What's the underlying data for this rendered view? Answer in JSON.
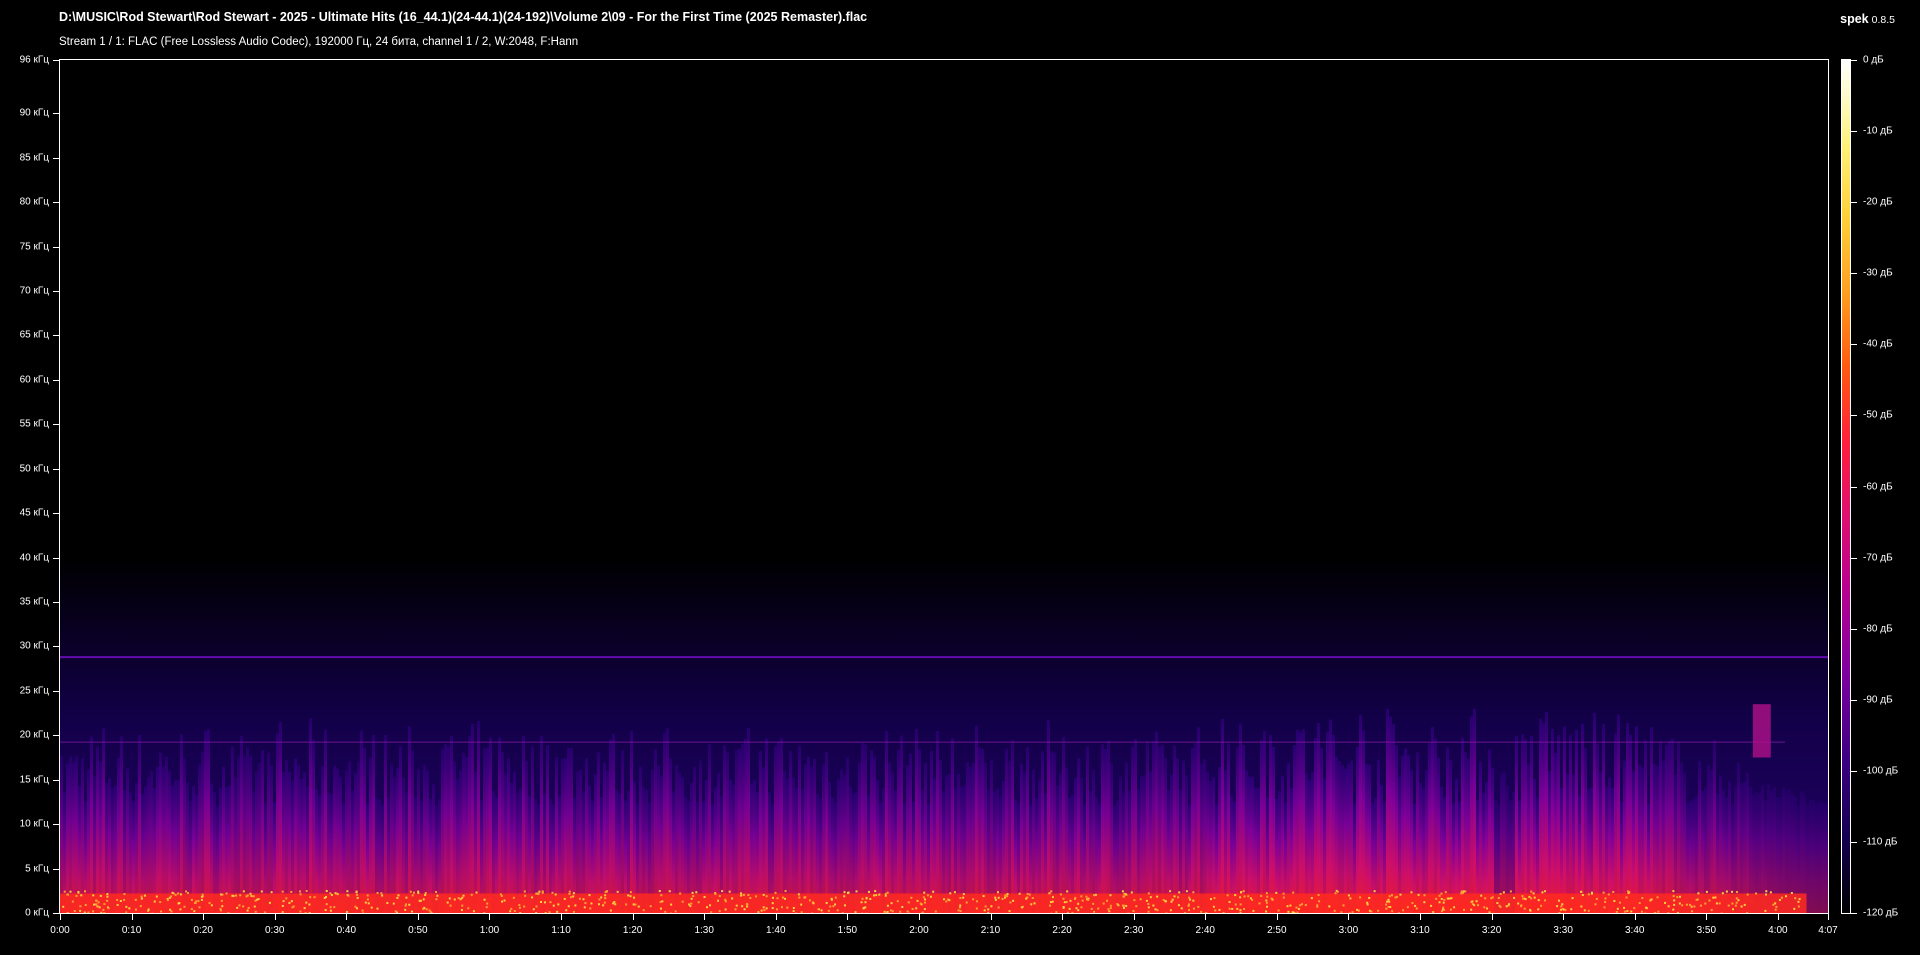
{
  "header": {
    "file_path": "D:\\MUSIC\\Rod Stewart\\Rod Stewart - 2025 - Ultimate Hits (16_44.1)(24-44.1)(24-192)\\Volume 2\\09 - For the First Time (2025 Remaster).flac",
    "stream_info": "Stream 1 / 1: FLAC (Free Lossless Audio Codec), 192000 Гц, 24 бита, channel 1 / 2, W:2048, F:Hann",
    "app_name": "spek",
    "app_version": "0.8.5"
  },
  "colors": {
    "background": "#000000",
    "text": "#ffffff",
    "noise_floor": "#0a0030",
    "body_low": "#c0105a",
    "body_high": "#ff2020",
    "peak": "#ffd040"
  },
  "chart_data": {
    "type": "heatmap",
    "description_free": true,
    "y_axis": {
      "unit": "кГц",
      "range": [
        0,
        96
      ],
      "ticks": [
        "0 кГц",
        "5 кГц",
        "10 кГц",
        "15 кГц",
        "20 кГц",
        "25 кГц",
        "30 кГц",
        "35 кГц",
        "40 кГц",
        "45 кГц",
        "50 кГц",
        "55 кГц",
        "60 кГц",
        "65 кГц",
        "70 кГц",
        "75 кГц",
        "80 кГц",
        "85 кГц",
        "90 кГц",
        "96 кГц"
      ],
      "tick_values": [
        0,
        5,
        10,
        15,
        20,
        25,
        30,
        35,
        40,
        45,
        50,
        55,
        60,
        65,
        70,
        75,
        80,
        85,
        90,
        96
      ]
    },
    "x_axis": {
      "range_seconds": [
        0,
        247
      ],
      "ticks": [
        "0:00",
        "0:10",
        "0:20",
        "0:30",
        "0:40",
        "0:50",
        "1:00",
        "1:10",
        "1:20",
        "1:30",
        "1:40",
        "1:50",
        "2:00",
        "2:10",
        "2:20",
        "2:30",
        "2:40",
        "2:50",
        "3:00",
        "3:10",
        "3:20",
        "3:30",
        "3:40",
        "3:50",
        "4:00",
        "4:07"
      ],
      "tick_values": [
        0,
        10,
        20,
        30,
        40,
        50,
        60,
        70,
        80,
        90,
        100,
        110,
        120,
        130,
        140,
        150,
        160,
        170,
        180,
        190,
        200,
        210,
        220,
        230,
        240,
        247
      ]
    },
    "color_scale": {
      "unit": "дБ",
      "range": [
        -120,
        0
      ],
      "ticks": [
        "0 дБ",
        "-10 дБ",
        "-20 дБ",
        "-30 дБ",
        "-40 дБ",
        "-50 дБ",
        "-60 дБ",
        "-70 дБ",
        "-80 дБ",
        "-90 дБ",
        "-100 дБ",
        "-110 дБ",
        "-120 дБ"
      ],
      "tick_values": [
        0,
        -10,
        -20,
        -30,
        -40,
        -50,
        -60,
        -70,
        -80,
        -90,
        -100,
        -110,
        -120
      ]
    },
    "features": {
      "noise_floor_khz": 40,
      "main_content_khz": 22,
      "steady_line_khz": 28.8,
      "steady_line_2_khz": 19.2
    }
  }
}
